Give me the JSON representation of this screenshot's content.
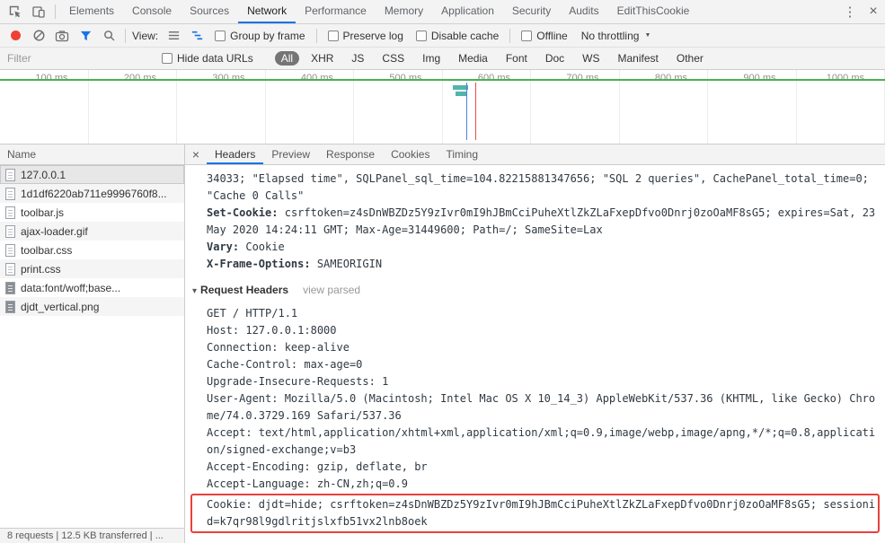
{
  "window": {
    "main_tabs": [
      "Elements",
      "Console",
      "Sources",
      "Network",
      "Performance",
      "Memory",
      "Application",
      "Security",
      "Audits",
      "EditThisCookie"
    ],
    "selected_tab": "Network",
    "kebab": "⋮",
    "close": "×"
  },
  "toolbar": {
    "view_label": "View:",
    "group_by_frame": "Group by frame",
    "preserve_log": "Preserve log",
    "disable_cache": "Disable cache",
    "offline": "Offline",
    "throttling": "No throttling",
    "dropdown_arrow": "▼"
  },
  "filter_bar": {
    "placeholder": "Filter",
    "hide_data_urls": "Hide data URLs",
    "types": [
      "All",
      "XHR",
      "JS",
      "CSS",
      "Img",
      "Media",
      "Font",
      "Doc",
      "WS",
      "Manifest",
      "Other"
    ],
    "selected_type": "All"
  },
  "timeline": {
    "ticks": [
      "100 ms",
      "200 ms",
      "300 ms",
      "400 ms",
      "500 ms",
      "600 ms",
      "700 ms",
      "800 ms",
      "900 ms",
      "1000 ms"
    ]
  },
  "requests": {
    "column_header": "Name",
    "rows": [
      {
        "name": "127.0.0.1"
      },
      {
        "name": "1d1df6220ab711e9996760f8..."
      },
      {
        "name": "toolbar.js"
      },
      {
        "name": "ajax-loader.gif"
      },
      {
        "name": "toolbar.css"
      },
      {
        "name": "print.css"
      },
      {
        "name": "data:font/woff;base..."
      },
      {
        "name": "djdt_vertical.png"
      }
    ],
    "selected_row": "127.0.0.1"
  },
  "details": {
    "close": "×",
    "tabs": [
      "Headers",
      "Preview",
      "Response",
      "Cookies",
      "Timing"
    ],
    "selected_tab": "Headers",
    "response_overflow": "34033; \"Elapsed time\", SQLPanel_sql_time=104.82215881347656; \"SQL 2 queries\", CachePanel_total_time=0; \"Cache 0 Calls\"",
    "response_headers": [
      {
        "name": "Set-Cookie:",
        "value": "csrftoken=z4sDnWBZDz5Y9zIvr0mI9hJBmCciPuheXtlZkZLaFxepDfvo0Dnrj0zoOaMF8sG5; expires=Sat, 23 May 2020 14:24:11 GMT; Max-Age=31449600; Path=/; SameSite=Lax"
      },
      {
        "name": "Vary:",
        "value": "Cookie"
      },
      {
        "name": "X-Frame-Options:",
        "value": "SAMEORIGIN"
      }
    ],
    "request_headers_section": {
      "toggle": "▾",
      "title": "Request Headers",
      "link": "view parsed",
      "lines": [
        "GET / HTTP/1.1",
        "Host: 127.0.0.1:8000",
        "Connection: keep-alive",
        "Cache-Control: max-age=0",
        "Upgrade-Insecure-Requests: 1",
        "User-Agent: Mozilla/5.0 (Macintosh; Intel Mac OS X 10_14_3) AppleWebKit/537.36 (KHTML, like Gecko) Chrome/74.0.3729.169 Safari/537.36",
        "Accept: text/html,application/xhtml+xml,application/xml;q=0.9,image/webp,image/apng,*/*;q=0.8,application/signed-exchange;v=b3",
        "Accept-Encoding: gzip, deflate, br",
        "Accept-Language: zh-CN,zh;q=0.9"
      ],
      "highlighted_line": "Cookie: djdt=hide; csrftoken=z4sDnWBZDz5Y9zIvr0mI9hJBmCciPuheXtlZkZLaFxepDfvo0Dnrj0zoOaMF8sG5; sessionid=k7qr98l9gdlritjslxfb51vx2lnb8oek"
    }
  },
  "status_bar": {
    "summary": "8 requests | 12.5 KB transferred | ..."
  },
  "colors": {
    "accent_blue": "#1a73e8",
    "record_red": "#ee4136",
    "highlight_red": "#e8413c",
    "timeline_green": "#4caf50",
    "waterfall_teal": "#52b5ab",
    "selected_pill_gray": "#757575"
  }
}
